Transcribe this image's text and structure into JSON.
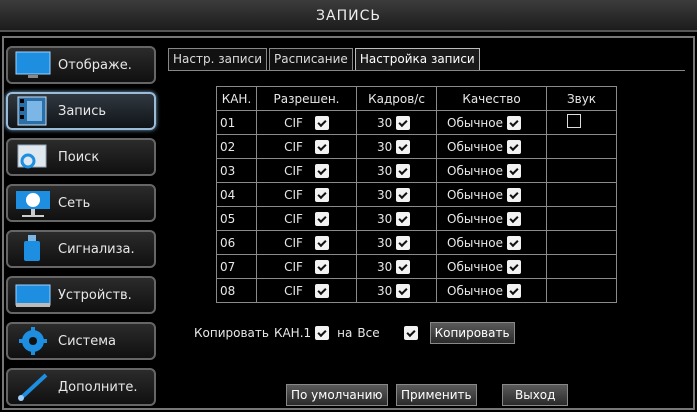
{
  "window": {
    "title": "ЗАПИСЬ"
  },
  "sidebar": {
    "items": [
      {
        "label": "Отображе.",
        "icon": "monitor-icon"
      },
      {
        "label": "Запись",
        "icon": "film-icon",
        "active": true
      },
      {
        "label": "Поиск",
        "icon": "search-icon"
      },
      {
        "label": "Сеть",
        "icon": "network-icon"
      },
      {
        "label": "Сигнализа.",
        "icon": "alarm-icon"
      },
      {
        "label": "Устройств.",
        "icon": "device-icon"
      },
      {
        "label": "Система",
        "icon": "gear-icon"
      },
      {
        "label": "Дополните.",
        "icon": "brush-icon"
      }
    ]
  },
  "tabs": [
    {
      "label": "Настр. записи"
    },
    {
      "label": "Расписание"
    },
    {
      "label": "Настройка записи",
      "active": true
    }
  ],
  "table": {
    "headers": [
      "КАН.",
      "Разрешен.",
      "Кадров/с",
      "Качество",
      "Звук"
    ],
    "rows": [
      {
        "ch": "01",
        "res": "CIF",
        "fps": "30",
        "quality": "Обычное",
        "sound": true
      },
      {
        "ch": "02",
        "res": "CIF",
        "fps": "30",
        "quality": "Обычное"
      },
      {
        "ch": "03",
        "res": "CIF",
        "fps": "30",
        "quality": "Обычное"
      },
      {
        "ch": "04",
        "res": "CIF",
        "fps": "30",
        "quality": "Обычное"
      },
      {
        "ch": "05",
        "res": "CIF",
        "fps": "30",
        "quality": "Обычное"
      },
      {
        "ch": "06",
        "res": "CIF",
        "fps": "30",
        "quality": "Обычное"
      },
      {
        "ch": "07",
        "res": "CIF",
        "fps": "30",
        "quality": "Обычное"
      },
      {
        "ch": "08",
        "res": "CIF",
        "fps": "30",
        "quality": "Обычное"
      }
    ]
  },
  "copy": {
    "label": "Копировать",
    "source": "КАН.1",
    "to_label": "на",
    "target": "Все",
    "button": "Копировать"
  },
  "footer": {
    "default_button": "По умолчанию",
    "apply_button": "Применить",
    "exit_button": "Выход"
  },
  "colors": {
    "accent": "#1e8fe0",
    "border": "#8a8a8a"
  }
}
